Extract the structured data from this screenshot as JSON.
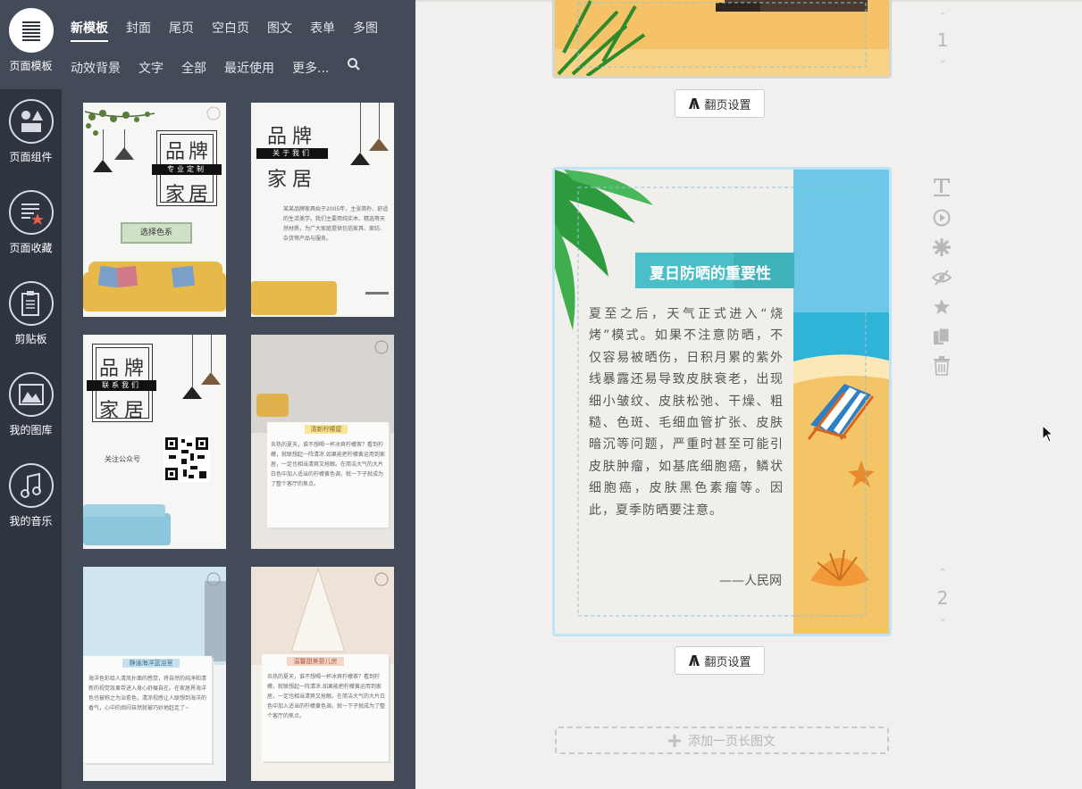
{
  "rail": {
    "items": [
      {
        "label": "页面模板",
        "icon": "list-lines-icon",
        "active": true
      },
      {
        "label": "页面组件",
        "icon": "shapes-icon"
      },
      {
        "label": "页面收藏",
        "icon": "favorites-list-icon"
      },
      {
        "label": "剪贴板",
        "icon": "clipboard-icon"
      },
      {
        "label": "我的图库",
        "icon": "mountain-image-icon"
      },
      {
        "label": "我的音乐",
        "icon": "music-note-icon"
      }
    ]
  },
  "panel": {
    "tabs_row1": [
      "新模板",
      "封面",
      "尾页",
      "空白页",
      "图文",
      "表单",
      "多图"
    ],
    "tabs_row2": [
      "动效背景",
      "文字",
      "全部",
      "最近使用",
      "更多..."
    ],
    "search_icon": "search-icon",
    "thumbs": {
      "t1": {
        "title_a": "品",
        "title_b": "牌",
        "tag": "专业定制",
        "title_c": "家",
        "title_d": "居",
        "button": "选择色系"
      },
      "t2": {
        "title": "品牌",
        "tag": "关于我们",
        "title2": "家居",
        "body": "某某品牌家具始于2005年，主张简朴、舒适的生活美学。我们主要用纯实木、精选等天然材质，为广大家庭提供包括家具、家纺、杂货等产品与服务。"
      },
      "t3": {
        "title": "品牌",
        "tag": "联系我们",
        "title2": "家居",
        "follow": "关注公众号"
      },
      "t4": {
        "label": "清新柠檬屋",
        "body": "炎热的夏天，谁不想喝一杯冰爽柠檬茶？看到柠檬，就联想起一阵清凉.如果能把柠檬黄运用到家居，一定也相当清爽又抢眼。在简洁大气的大片白色中加入适当的柠檬黄色调，就一下子就成为了整个客厅的焦点。"
      },
      "t5": {
        "label": "静谧海洋蓝浴室",
        "body": "海洋色彩给人清风扑面的感觉，将自然的纯净和清新的视觉效果带进入身心舒展自在。在家居界海洋色也被称之为治愈色，清凉视感让人联想到海洋的香气，心中的烦闷自然就被巧妙地赶走了~"
      },
      "t6": {
        "label": "温馨甜美婴儿房",
        "body": "炎热的夏天，谁不想喝一杯冰爽柠檬茶？看到柠檬，就联想起一阵清凉.如果能把柠檬黄运用到家居，一定也相当清爽又抢眼。在简洁大气的大片白色中加入适当的柠檬黄色调，就一下子就成为了整个客厅的焦点。"
      }
    }
  },
  "main": {
    "flip_label": "翻页设置",
    "page1_num": "1",
    "page2_num": "2",
    "page2": {
      "title": "夏日防晒的重要性",
      "body": "夏至之后，天气正式进入“烧烤”模式。如果不注意防晒，不仅容易被晒伤，日积月累的紫外线暴露还易导致皮肤衰老，出现细小皱纹、皮肤松弛、干燥、粗糙、色斑、毛细血管扩张、皮肤暗沉等问题，严重时甚至可能引皮肤肿瘤，如基底细胞癌，鳞状细胞癌，皮肤黑色素瘤等。因此，夏季防晒要注意。",
      "source": "——人民网"
    },
    "tools": [
      "text-tool-icon",
      "play-circle-icon",
      "gear-icon",
      "eye-slash-icon",
      "star-icon",
      "copy-icon",
      "trash-icon"
    ],
    "add_label": "添加一页长图文"
  },
  "colors": {
    "rail_bg": "#2e3440",
    "panel_bg": "#434a58",
    "accent_teal": "#4bbfc7",
    "sand": "#f7c46e"
  }
}
